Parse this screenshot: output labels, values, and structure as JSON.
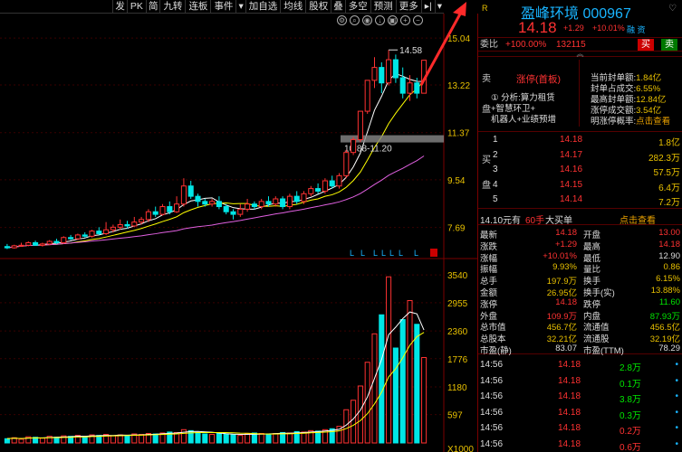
{
  "toolbar": {
    "buttons": [
      "发",
      "PK",
      "简",
      "九转",
      "连板",
      "事件",
      "▾",
      "加自选",
      "均线",
      "股权",
      "叠",
      "多空",
      "预测",
      "更多",
      "▸|",
      "▾"
    ]
  },
  "chart_data": [
    {
      "type": "candlestick",
      "title": "",
      "y_ticks": [
        "15.04",
        "13.22",
        "11.37",
        "9.54",
        "7.69"
      ],
      "y_range": [
        6.8,
        15.5
      ],
      "annotations": {
        "high_label": "14.58",
        "range_label": "10.88-11.20"
      },
      "limit_markers": [
        "L",
        "L",
        "L",
        "L",
        "L",
        "L",
        "L",
        "L"
      ],
      "candles": [
        {
          "o": 6.95,
          "c": 6.9,
          "h": 7.05,
          "l": 6.85
        },
        {
          "o": 6.9,
          "c": 6.98,
          "h": 7.02,
          "l": 6.87
        },
        {
          "o": 6.98,
          "c": 7.0,
          "h": 7.1,
          "l": 6.95
        },
        {
          "o": 7.0,
          "c": 7.1,
          "h": 7.15,
          "l": 6.96
        },
        {
          "o": 7.1,
          "c": 7.0,
          "h": 7.18,
          "l": 6.98
        },
        {
          "o": 7.0,
          "c": 7.05,
          "h": 7.1,
          "l": 6.95
        },
        {
          "o": 7.05,
          "c": 7.15,
          "h": 7.2,
          "l": 7.0
        },
        {
          "o": 7.15,
          "c": 7.1,
          "h": 7.25,
          "l": 7.05
        },
        {
          "o": 7.1,
          "c": 7.3,
          "h": 7.35,
          "l": 7.05
        },
        {
          "o": 7.3,
          "c": 7.25,
          "h": 7.4,
          "l": 7.2
        },
        {
          "o": 7.25,
          "c": 7.4,
          "h": 7.45,
          "l": 7.2
        },
        {
          "o": 7.4,
          "c": 7.35,
          "h": 7.5,
          "l": 7.3
        },
        {
          "o": 7.35,
          "c": 7.55,
          "h": 7.6,
          "l": 7.3
        },
        {
          "o": 7.55,
          "c": 7.45,
          "h": 7.7,
          "l": 7.4
        },
        {
          "o": 7.45,
          "c": 7.6,
          "h": 7.9,
          "l": 7.4
        },
        {
          "o": 7.6,
          "c": 7.7,
          "h": 7.8,
          "l": 7.5
        },
        {
          "o": 7.7,
          "c": 7.8,
          "h": 8.0,
          "l": 7.6
        },
        {
          "o": 7.8,
          "c": 7.75,
          "h": 7.95,
          "l": 7.65
        },
        {
          "o": 7.75,
          "c": 7.9,
          "h": 8.1,
          "l": 7.7
        },
        {
          "o": 7.9,
          "c": 8.0,
          "h": 8.1,
          "l": 7.8
        },
        {
          "o": 8.0,
          "c": 8.3,
          "h": 8.4,
          "l": 7.9
        },
        {
          "o": 8.3,
          "c": 8.2,
          "h": 8.5,
          "l": 8.1
        },
        {
          "o": 8.2,
          "c": 8.5,
          "h": 8.6,
          "l": 8.15
        },
        {
          "o": 8.5,
          "c": 8.3,
          "h": 8.7,
          "l": 8.2
        },
        {
          "o": 8.3,
          "c": 8.6,
          "h": 8.9,
          "l": 8.25
        },
        {
          "o": 8.6,
          "c": 9.3,
          "h": 9.6,
          "l": 8.5
        },
        {
          "o": 9.3,
          "c": 8.9,
          "h": 9.5,
          "l": 8.8
        },
        {
          "o": 8.9,
          "c": 8.7,
          "h": 9.0,
          "l": 8.5
        },
        {
          "o": 8.7,
          "c": 8.6,
          "h": 8.8,
          "l": 8.5
        },
        {
          "o": 8.6,
          "c": 8.7,
          "h": 8.8,
          "l": 8.5
        },
        {
          "o": 8.7,
          "c": 8.5,
          "h": 8.9,
          "l": 8.4
        },
        {
          "o": 8.5,
          "c": 8.3,
          "h": 8.6,
          "l": 8.2
        },
        {
          "o": 8.3,
          "c": 8.2,
          "h": 8.4,
          "l": 8.0
        },
        {
          "o": 8.2,
          "c": 8.4,
          "h": 8.6,
          "l": 8.1
        },
        {
          "o": 8.4,
          "c": 8.6,
          "h": 8.8,
          "l": 8.3
        },
        {
          "o": 8.6,
          "c": 8.5,
          "h": 8.7,
          "l": 8.4
        },
        {
          "o": 8.5,
          "c": 8.7,
          "h": 8.8,
          "l": 8.4
        },
        {
          "o": 8.7,
          "c": 8.6,
          "h": 8.9,
          "l": 8.5
        },
        {
          "o": 8.6,
          "c": 8.8,
          "h": 8.9,
          "l": 8.5
        },
        {
          "o": 8.8,
          "c": 8.5,
          "h": 8.9,
          "l": 8.4
        },
        {
          "o": 8.5,
          "c": 8.9,
          "h": 9.0,
          "l": 8.4
        },
        {
          "o": 8.9,
          "c": 8.7,
          "h": 9.1,
          "l": 8.6
        },
        {
          "o": 8.7,
          "c": 9.0,
          "h": 9.1,
          "l": 8.6
        },
        {
          "o": 9.0,
          "c": 9.2,
          "h": 9.3,
          "l": 8.9
        },
        {
          "o": 9.2,
          "c": 9.1,
          "h": 9.4,
          "l": 9.0
        },
        {
          "o": 9.1,
          "c": 9.5,
          "h": 9.6,
          "l": 9.0
        },
        {
          "o": 9.5,
          "c": 9.3,
          "h": 9.7,
          "l": 9.2
        },
        {
          "o": 9.3,
          "c": 9.7,
          "h": 9.8,
          "l": 9.2
        },
        {
          "o": 9.7,
          "c": 10.6,
          "h": 10.7,
          "l": 9.6
        },
        {
          "o": 10.6,
          "c": 11.1,
          "h": 11.2,
          "l": 10.5
        },
        {
          "o": 11.1,
          "c": 12.2,
          "h": 12.2,
          "l": 11.0
        },
        {
          "o": 12.2,
          "c": 13.4,
          "h": 13.4,
          "l": 12.1
        },
        {
          "o": 13.4,
          "c": 13.9,
          "h": 14.3,
          "l": 13.1
        },
        {
          "o": 13.9,
          "c": 13.3,
          "h": 14.1,
          "l": 12.9
        },
        {
          "o": 13.3,
          "c": 14.2,
          "h": 14.58,
          "l": 13.2
        },
        {
          "o": 14.2,
          "c": 13.5,
          "h": 14.4,
          "l": 13.3
        },
        {
          "o": 13.5,
          "c": 12.9,
          "h": 13.9,
          "l": 12.7
        },
        {
          "o": 12.9,
          "c": 13.3,
          "h": 13.6,
          "l": 12.6
        },
        {
          "o": 13.3,
          "c": 12.9,
          "h": 13.5,
          "l": 12.7
        },
        {
          "o": 12.9,
          "c": 14.18,
          "h": 14.18,
          "l": 12.9
        }
      ]
    },
    {
      "type": "bar",
      "title": "",
      "y_ticks": [
        "3540",
        "2955",
        "2360",
        "1776",
        "1180",
        "597",
        "X1000"
      ],
      "y_range": [
        0,
        3600
      ],
      "volumes": [
        90,
        110,
        80,
        130,
        120,
        100,
        140,
        120,
        150,
        140,
        160,
        130,
        170,
        160,
        180,
        150,
        170,
        160,
        190,
        180,
        200,
        190,
        210,
        230,
        220,
        280,
        260,
        220,
        190,
        180,
        200,
        190,
        170,
        160,
        190,
        210,
        200,
        190,
        200,
        220,
        210,
        240,
        230,
        260,
        250,
        280,
        300,
        350,
        700,
        900,
        1200,
        1700,
        2300,
        2700,
        3500,
        2000,
        2600,
        3000,
        2500,
        1800
      ]
    }
  ],
  "stock": {
    "r_badge": "R",
    "name_code": "盈峰环境 000967",
    "price": "14.18",
    "change": "+1.29",
    "pct": "+10.01%",
    "tag": "融 资",
    "option": "♡"
  },
  "weibi": {
    "label": "委比",
    "value": "+100.00%",
    "diff": "132115",
    "buy_btn": "买",
    "sell_btn": "卖"
  },
  "toggle": "︽",
  "limit_box": {
    "side_label": "卖\n\n\n盘",
    "title": "涨停(首板)",
    "reason_1": "① 分析:算力租赁",
    "reason_2": "+智慧环卫+",
    "reason_3": "机器人+业绩预增",
    "stats": [
      {
        "label": "当前封单额:",
        "value": "1.84亿"
      },
      {
        "label": "封单占成交:",
        "value": "6.55%"
      },
      {
        "label": "最高封单额:",
        "value": "12.84亿"
      },
      {
        "label": "涨停成交额:",
        "value": "3.54亿"
      },
      {
        "label": "明涨停概率:",
        "value": "点击查看"
      }
    ]
  },
  "bids": {
    "side": "买\n\n盘",
    "rows": [
      {
        "lvl": "1",
        "price": "14.18",
        "vol": "1.8亿"
      },
      {
        "lvl": "2",
        "price": "14.17",
        "vol": "282.3万"
      },
      {
        "lvl": "3",
        "price": "14.16",
        "vol": "57.5万"
      },
      {
        "lvl": "4",
        "price": "14.15",
        "vol": "6.4万"
      },
      {
        "lvl": "5",
        "price": "14.14",
        "vol": "7.2万"
      }
    ]
  },
  "tab": {
    "left": "14.10元有",
    "mid": "60手",
    "right_text": "大买单",
    "link": "点击查看"
  },
  "quote": [
    {
      "l1": "最新",
      "v1": "14.18",
      "c1": "red",
      "l2": "开盘",
      "v2": "13.00",
      "c2": "red"
    },
    {
      "l1": "涨跌",
      "v1": "+1.29",
      "c1": "red",
      "l2": "最高",
      "v2": "14.18",
      "c2": "red"
    },
    {
      "l1": "涨幅",
      "v1": "+10.01%",
      "c1": "red",
      "l2": "最低",
      "v2": "12.90",
      "c2": "wht"
    },
    {
      "l1": "振幅",
      "v1": "9.93%",
      "c1": "yel",
      "l2": "量比",
      "v2": "0.86",
      "c2": "yel"
    },
    {
      "l1": "总手",
      "v1": "197.9万",
      "c1": "yel",
      "l2": "换手",
      "v2": "6.15%",
      "c2": "yel"
    },
    {
      "l1": "金额",
      "v1": "26.95亿",
      "c1": "yel",
      "l2": "换手(实)",
      "v2": "13.88%",
      "c2": "yel"
    },
    {
      "l1": "涨停",
      "v1": "14.18",
      "c1": "red",
      "l2": "跌停",
      "v2": "11.60",
      "c2": "green"
    },
    {
      "l1": "外盘",
      "v1": "109.9万",
      "c1": "red",
      "l2": "内盘",
      "v2": "87.93万",
      "c2": "green"
    },
    {
      "l1": "总市值",
      "v1": "456.7亿",
      "c1": "yel",
      "l2": "流通值",
      "v2": "456.5亿",
      "c2": "yel"
    },
    {
      "l1": "总股本",
      "v1": "32.21亿",
      "c1": "yel",
      "l2": "流通股",
      "v2": "32.19亿",
      "c2": "yel"
    },
    {
      "l1": "市盈(静)",
      "v1": "83.07",
      "c1": "wht",
      "l2": "市盈(TTM)",
      "v2": "78.29",
      "c2": "wht"
    }
  ],
  "ticks": [
    {
      "time": "14:56",
      "price": "14.18",
      "vol": "2.8万",
      "vc": "green"
    },
    {
      "time": "14:56",
      "price": "14.18",
      "vol": "0.1万",
      "vc": "green"
    },
    {
      "time": "14:56",
      "price": "14.18",
      "vol": "3.8万",
      "vc": "green"
    },
    {
      "time": "14:56",
      "price": "14.18",
      "vol": "0.3万",
      "vc": "green"
    },
    {
      "time": "14:56",
      "price": "14.18",
      "vol": "0.2万",
      "vc": "red"
    },
    {
      "time": "14:56",
      "price": "14.18",
      "vol": "0.6万",
      "vc": "red"
    }
  ]
}
